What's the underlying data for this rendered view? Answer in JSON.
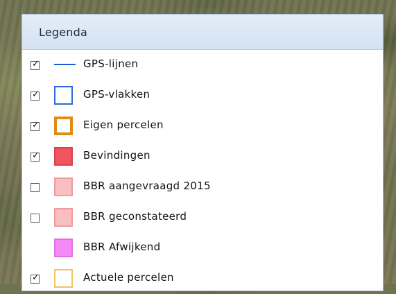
{
  "legend": {
    "title": "Legenda",
    "items": [
      {
        "label": "GPS-lijnen",
        "checked": true,
        "has_checkbox": true,
        "symbol": "line",
        "stroke": "#1a5fd0"
      },
      {
        "label": "GPS-vlakken",
        "checked": true,
        "has_checkbox": true,
        "symbol": "box",
        "fill": "#ffffff",
        "stroke": "#2c6bd6"
      },
      {
        "label": "Eigen percelen",
        "checked": true,
        "has_checkbox": true,
        "symbol": "box",
        "fill": "#ffffff",
        "stroke": "#e08e12"
      },
      {
        "label": "Bevindingen",
        "checked": true,
        "has_checkbox": true,
        "symbol": "box",
        "fill": "#f2545f",
        "stroke": "#d9434d"
      },
      {
        "label": "BBR aangevraagd 2015",
        "checked": false,
        "has_checkbox": true,
        "symbol": "box",
        "fill": "#f9bfc1",
        "stroke": "#ee9a9e"
      },
      {
        "label": "BBR geconstateerd",
        "checked": false,
        "has_checkbox": true,
        "symbol": "box",
        "fill": "#f9bfc1",
        "stroke": "#ee9a9e"
      },
      {
        "label": "BBR Afwijkend",
        "checked": false,
        "has_checkbox": false,
        "symbol": "box",
        "fill": "#f58af7",
        "stroke": "#e070e5"
      },
      {
        "label": "Actuele percelen",
        "checked": true,
        "has_checkbox": true,
        "symbol": "box",
        "fill": "#ffffff",
        "stroke": "#f0c65a"
      }
    ]
  }
}
